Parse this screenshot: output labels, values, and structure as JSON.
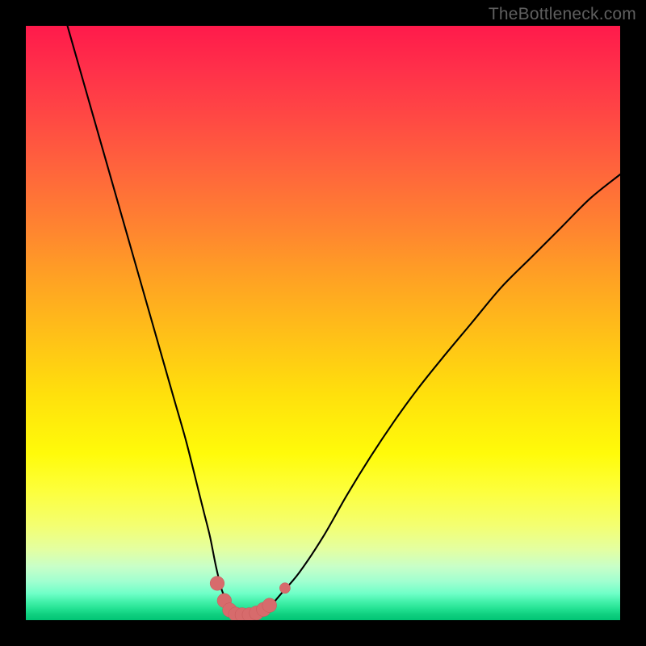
{
  "watermark": {
    "text": "TheBottleneck.com"
  },
  "colors": {
    "curve_stroke": "#000000",
    "marker_fill": "#d76b6c",
    "marker_stroke": "#c7585a"
  },
  "chart_data": {
    "type": "line",
    "title": "",
    "xlabel": "",
    "ylabel": "",
    "xlim": [
      0,
      100
    ],
    "ylim": [
      0,
      100
    ],
    "grid": false,
    "legend": false,
    "series": [
      {
        "name": "bottleneck-curve",
        "x": [
          7,
          9,
          11,
          13,
          15,
          17,
          19,
          21,
          23,
          25,
          27,
          29,
          30,
          31,
          32,
          33,
          34,
          35,
          36,
          37,
          38,
          39,
          41,
          43,
          46,
          50,
          54,
          58,
          62,
          66,
          70,
          75,
          80,
          85,
          90,
          95,
          100
        ],
        "y": [
          100,
          93,
          86,
          79,
          72,
          65,
          58,
          51,
          44,
          37,
          30,
          22,
          18,
          14,
          9,
          5,
          3,
          1.5,
          1,
          1,
          1,
          1.3,
          2.3,
          4.5,
          8,
          14,
          21,
          27.5,
          33.5,
          39,
          44,
          50,
          56,
          61,
          66,
          71,
          75
        ]
      }
    ],
    "markers": {
      "name": "bottom-cluster",
      "points": [
        {
          "x": 32.2,
          "y": 6.2,
          "r": 1.2
        },
        {
          "x": 33.4,
          "y": 3.3,
          "r": 1.2
        },
        {
          "x": 34.3,
          "y": 1.7,
          "r": 1.2
        },
        {
          "x": 35.3,
          "y": 1.0,
          "r": 1.2
        },
        {
          "x": 36.4,
          "y": 0.9,
          "r": 1.2
        },
        {
          "x": 37.6,
          "y": 0.9,
          "r": 1.2
        },
        {
          "x": 38.8,
          "y": 1.2,
          "r": 1.2
        },
        {
          "x": 40.0,
          "y": 1.8,
          "r": 1.2
        },
        {
          "x": 41.0,
          "y": 2.5,
          "r": 1.2
        },
        {
          "x": 43.6,
          "y": 5.4,
          "r": 0.9
        }
      ]
    }
  }
}
